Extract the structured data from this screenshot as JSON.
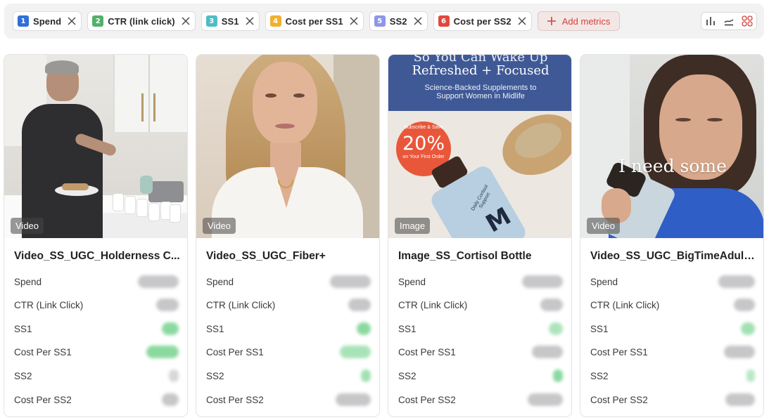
{
  "toolbar": {
    "chips": [
      {
        "num": "1",
        "label": "Spend",
        "color": "#2f6fd8"
      },
      {
        "num": "2",
        "label": "CTR (link click)",
        "color": "#52b06a"
      },
      {
        "num": "3",
        "label": "SS1",
        "color": "#4fbcc4"
      },
      {
        "num": "4",
        "label": "Cost per SS1",
        "color": "#f0b030"
      },
      {
        "num": "5",
        "label": "SS2",
        "color": "#8d96e8"
      },
      {
        "num": "6",
        "label": "Cost per SS2",
        "color": "#e0493d"
      }
    ],
    "add_label": "Add metrics",
    "accent": "#d2413a"
  },
  "cards": [
    {
      "media_type": "Video",
      "title": "Video_SS_UGC_Holderness C...",
      "metrics": [
        {
          "label": "Spend"
        },
        {
          "label": "CTR (Link Click)"
        },
        {
          "label": "SS1"
        },
        {
          "label": "Cost Per SS1"
        },
        {
          "label": "SS2"
        },
        {
          "label": "Cost Per SS2"
        }
      ]
    },
    {
      "media_type": "Video",
      "title": "Video_SS_UGC_Fiber+",
      "metrics": [
        {
          "label": "Spend"
        },
        {
          "label": "CTR (Link Click)"
        },
        {
          "label": "SS1"
        },
        {
          "label": "Cost Per SS1"
        },
        {
          "label": "SS2"
        },
        {
          "label": "Cost Per SS2"
        }
      ]
    },
    {
      "media_type": "Image",
      "title": "Image_SS_Cortisol Bottle",
      "ad_text": {
        "headline_top": "So You Can Wake Up",
        "headline_bottom": "Refreshed + Focused",
        "sub_line1": "Science-Backed Supplements to",
        "sub_line2": "Support Women in Midlife",
        "badge_top": "Subscribe & Save",
        "badge_pct": "20%",
        "badge_bottom": "on Your First Order",
        "bottle_text": "Daily Cortisol Support"
      },
      "metrics": [
        {
          "label": "Spend"
        },
        {
          "label": "CTR (Link Click)"
        },
        {
          "label": "SS1"
        },
        {
          "label": "Cost Per SS1"
        },
        {
          "label": "SS2"
        },
        {
          "label": "Cost Per SS2"
        }
      ]
    },
    {
      "media_type": "Video",
      "title": "Video_SS_UGC_BigTimeAdult...",
      "caption": "I need some",
      "metrics": [
        {
          "label": "Spend"
        },
        {
          "label": "CTR (Link Click)"
        },
        {
          "label": "SS1"
        },
        {
          "label": "Cost Per SS1"
        },
        {
          "label": "SS2"
        },
        {
          "label": "Cost Per SS2"
        }
      ]
    }
  ]
}
